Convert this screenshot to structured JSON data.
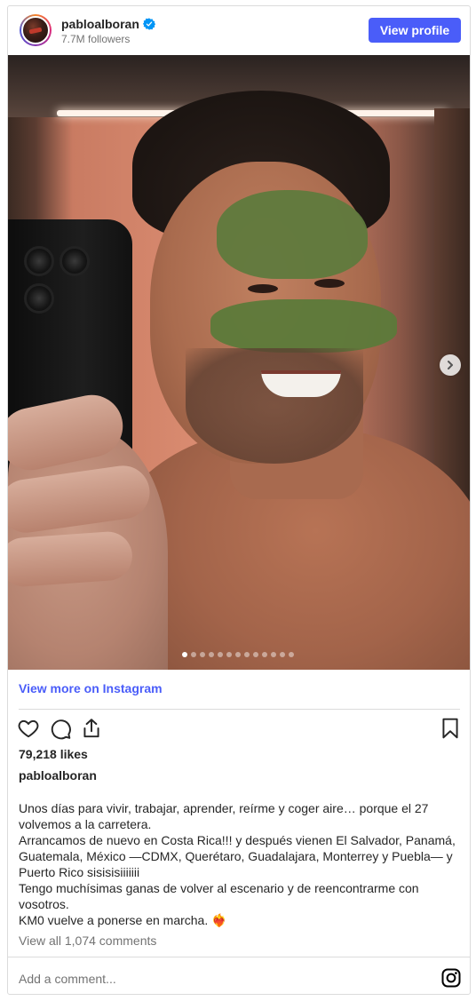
{
  "header": {
    "username": "pabloalboran",
    "verified": true,
    "followers": "7.7M followers",
    "view_profile_label": "View profile"
  },
  "media": {
    "description": "",
    "carousel": {
      "total": 13,
      "active_index": 0
    }
  },
  "view_more_label": "View more on Instagram",
  "actions": {
    "icons": [
      "heart-icon",
      "comment-icon",
      "share-icon",
      "bookmark-icon"
    ]
  },
  "likes": "79,218 likes",
  "caption": {
    "username": "pabloalboran",
    "lines": [
      "Unos días para vivir, trabajar, aprender, reírme y coger aire… porque el 27 volvemos a la carretera.",
      "Arrancamos de nuevo en Costa Rica!!! y después vienen El Salvador, Panamá, Guatemala, México —CDMX, Querétaro, Guadalajara, Monterrey y Puebla— y Puerto Rico sisisisiiiiiii",
      "Tengo muchísimas ganas de volver al escenario y de reencontrarme con vosotros.",
      "KM0 vuelve a ponerse en marcha. ❤️‍🔥"
    ]
  },
  "view_comments": "View all 1,074 comments",
  "add_comment_placeholder": "Add a comment...",
  "colors": {
    "accent": "#4a5df9",
    "border": "#dbdbdb",
    "muted_text": "#737373",
    "text": "#262626"
  }
}
